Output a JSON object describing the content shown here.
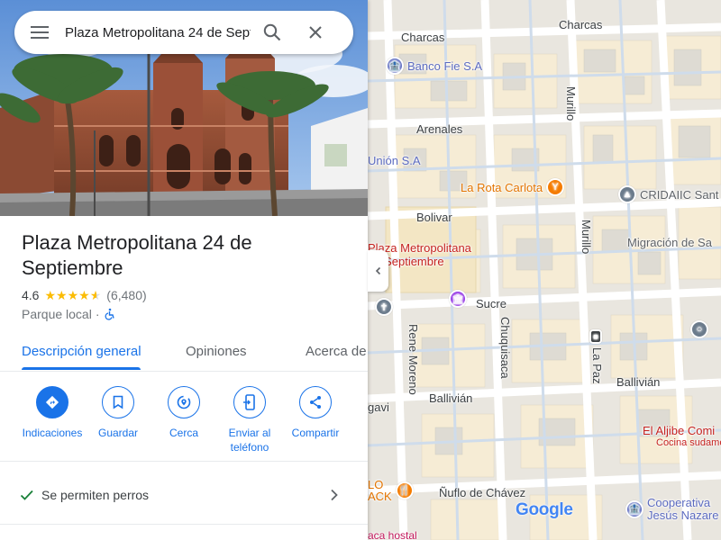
{
  "search": {
    "value": "Plaza Metropolitana 24 de Sept"
  },
  "place": {
    "title": "Plaza Metropolitana 24 de Septiembre",
    "rating": "4.6",
    "stars": 4.6,
    "reviews": "(6,480)",
    "category": "Parque local",
    "separator": "·"
  },
  "tabs": [
    {
      "label": "Descripción general",
      "active": true
    },
    {
      "label": "Opiniones",
      "active": false
    },
    {
      "label": "Acerca de",
      "active": false
    }
  ],
  "actions": [
    {
      "label": "Indicaciones",
      "icon": "directions-icon"
    },
    {
      "label": "Guardar",
      "icon": "bookmark-icon"
    },
    {
      "label": "Cerca",
      "icon": "nearby-icon"
    },
    {
      "label": "Enviar al teléfono",
      "icon": "send-to-phone-icon"
    },
    {
      "label": "Compartir",
      "icon": "share-icon"
    }
  ],
  "amenity": {
    "label": "Se permiten perros"
  },
  "map": {
    "streets": {
      "charcas_left": "Charcas",
      "charcas_right": "Charcas",
      "arenales": "Arenales",
      "bolivar": "Bolivar",
      "sucre": "Sucre",
      "ballivian_left": "Ballivián",
      "ballivian_right": "Ballivián",
      "ayacucho": "gavi",
      "nuflo": "Ñuflo de Chávez",
      "murillo_top": "Murillo",
      "murillo_mid": "Murillo",
      "chuquisaca": "Chuquisaca",
      "la_paz": "La Paz",
      "rene_moreno": "Rene Moreno"
    },
    "pois": {
      "banco_fie": "Banco Fie S.A",
      "union": "Unión S.A",
      "la_rota": "La Rota Carlota",
      "cridaiic": "CRIDAIIC Sant",
      "migracion": "Migración de Sa",
      "plaza_line1": "Plaza Metropolitana",
      "plaza_line2": "de Septiembre",
      "el_aljibe": "El Aljibe Comi",
      "el_aljibe_sub": "Cocina sudamer",
      "lo_ack_1": "LO",
      "lo_ack_2": "ACK",
      "cooperativa_1": "Cooperativa",
      "cooperativa_2": "Jesús Nazare",
      "casa_hostal": "aca hostal"
    },
    "logo": "Google"
  },
  "colors": {
    "accent": "#1a73e8",
    "star": "#fbbc04",
    "poi_red": "#c5221f",
    "poi_orange": "#f57c00",
    "poi_purple": "#9334e6",
    "poi_gray": "#6b7b8c"
  }
}
